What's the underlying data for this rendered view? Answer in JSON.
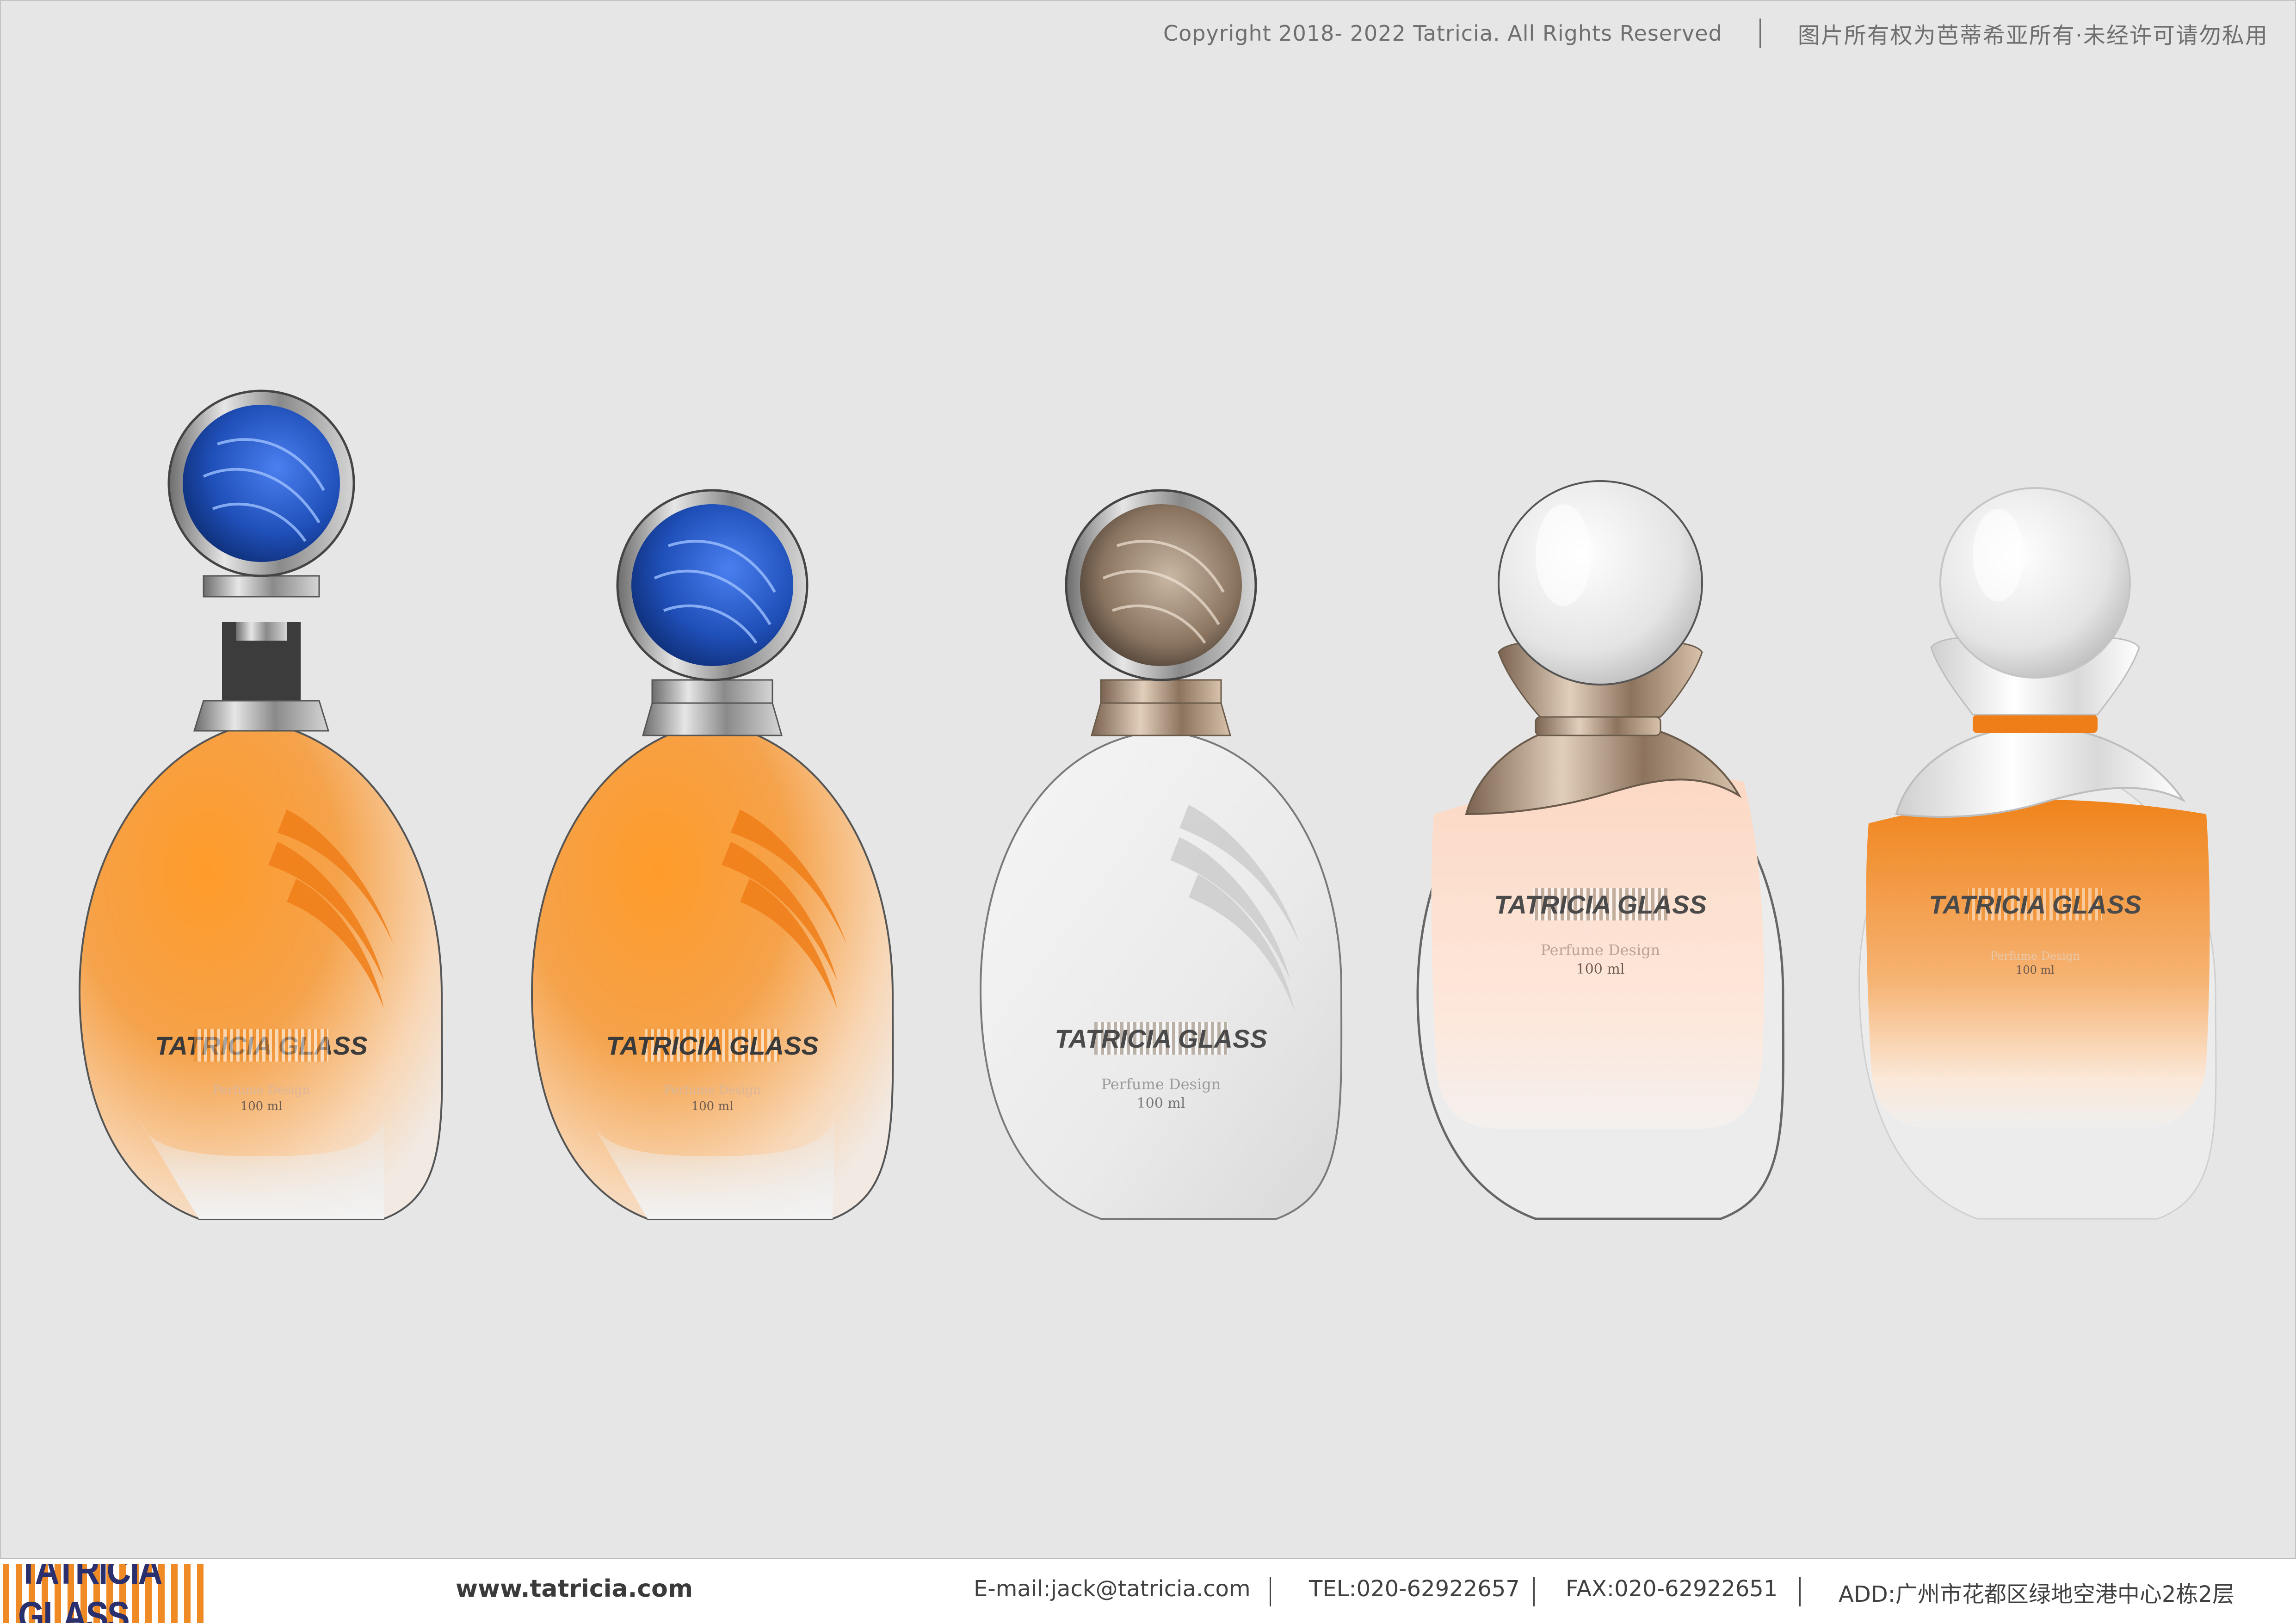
{
  "header": {
    "copyright": "Copyright 2018- 2022 Tatricia. All Rights Reserved",
    "rights_cn": "图片所有权为芭蒂希亚所有·未经许可请勿私用"
  },
  "bottles": [
    {
      "brand": "TATRICIA GLASS",
      "line1": "Perfume Design",
      "line2": "100 ml"
    },
    {
      "brand": "TATRICIA GLASS",
      "line1": "Perfume Design",
      "line2": "100 ml"
    },
    {
      "brand": "TATRICIA GLASS",
      "line1": "Perfume Design",
      "line2": "100 ml"
    },
    {
      "brand": "TATRICIA GLASS",
      "line1": "Perfume Design",
      "line2": "100 ml"
    },
    {
      "brand": "TATRICIA GLASS",
      "line1": "Perfume Design",
      "line2": "100 ml"
    }
  ],
  "footer": {
    "logo": "TATRICIA GLASS",
    "website": "www.tatricia.com",
    "email": "E-mail:jack@tatricia.com",
    "tel": "TEL:020-62922657",
    "fax": "FAX:020-62922651",
    "address": "ADD:广州市花都区绿地空港中心2栋2层"
  },
  "colors": {
    "orange": "#f08a24",
    "navy": "#2a2f6e",
    "cap_blue": "#2a5bd0",
    "cap_bronze": "#8a7460"
  }
}
